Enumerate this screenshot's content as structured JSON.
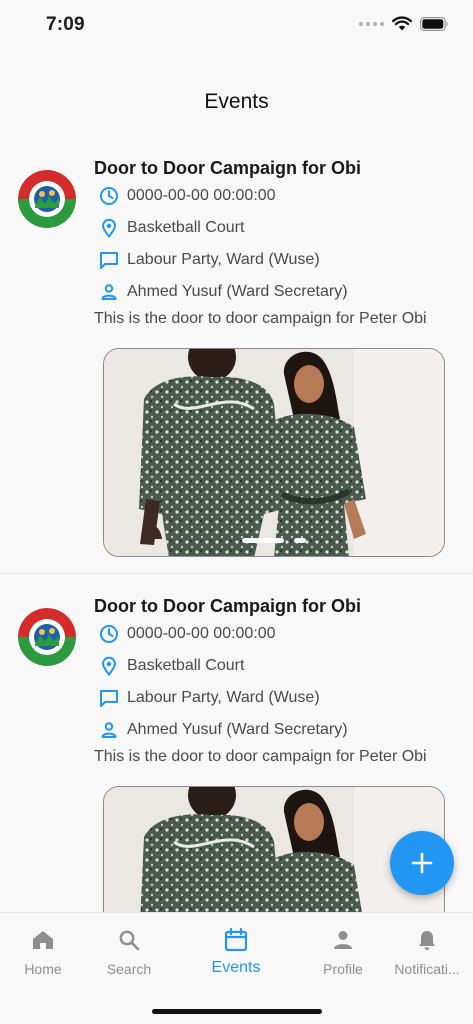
{
  "status_bar": {
    "time": "7:09"
  },
  "header": {
    "title": "Events"
  },
  "events": [
    {
      "title": "Door to Door Campaign for Obi",
      "datetime": "0000-00-00 00:00:00",
      "location": "Basketball Court",
      "organization": "Labour Party, Ward (Wuse)",
      "contact": "Ahmed Yusuf (Ward Secretary)",
      "description": "This is the door to door campaign for Peter Obi"
    },
    {
      "title": "Door to Door Campaign for Obi",
      "datetime": "0000-00-00 00:00:00",
      "location": "Basketball Court",
      "organization": "Labour Party, Ward (Wuse)",
      "contact": "Ahmed Yusuf (Ward Secretary)",
      "description": "This is the door to door campaign for Peter Obi"
    }
  ],
  "fab": {
    "icon": "plus-icon"
  },
  "bottom_nav": {
    "items": [
      {
        "label": "Home",
        "icon": "home-icon"
      },
      {
        "label": "Search",
        "icon": "search-icon"
      },
      {
        "label": "Events",
        "icon": "calendar-icon",
        "active": true
      },
      {
        "label": "Profile",
        "icon": "person-icon"
      },
      {
        "label": "Notificati...",
        "icon": "bell-icon"
      }
    ]
  },
  "colors": {
    "accent": "#2296f3",
    "inactive": "#8e8e8e",
    "background": "#f8f8f8"
  }
}
